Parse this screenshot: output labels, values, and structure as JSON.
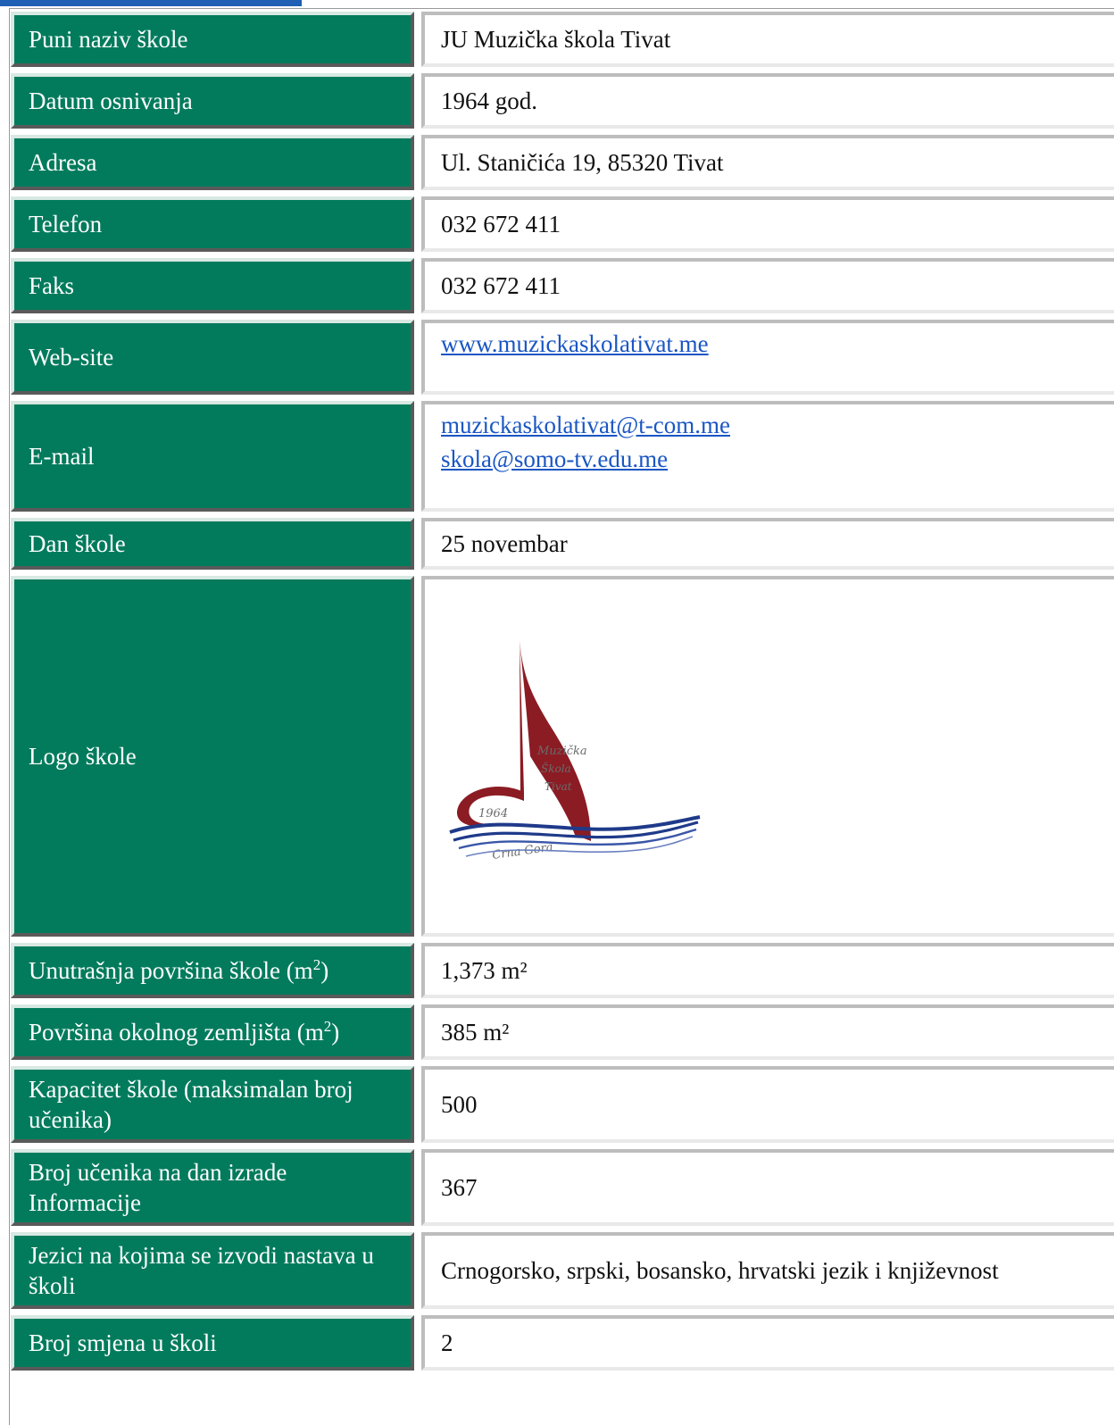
{
  "rows": {
    "full_name": {
      "label": "Puni naziv škole",
      "value": "JU Muzička škola Tivat"
    },
    "founded": {
      "label": "Datum osnivanja",
      "value": "1964 god."
    },
    "address": {
      "label": "Adresa",
      "value": "Ul. Staničića 19, 85320 Tivat"
    },
    "phone": {
      "label": "Telefon",
      "value": "032 672 411"
    },
    "fax": {
      "label": "Faks",
      "value": "032 672 411"
    },
    "website": {
      "label": "Web-site",
      "value": "www.muzickaskolativat.me"
    },
    "email": {
      "label": "E-mail",
      "value_1": "muzickaskolativat@t-com.me",
      "value_2": "skola@somo-tv.edu.me"
    },
    "school_day": {
      "label": "Dan škole",
      "value": "25 novembar"
    },
    "logo": {
      "label": "Logo škole",
      "logo_text": [
        "Muzička",
        "Škola",
        "Tivat",
        "1964",
        "Crna Gora"
      ]
    },
    "inner_area": {
      "label": "Unutrašnja površina škole (m",
      "label_sup": "2",
      "label_end": ")",
      "value": "1,373 m²"
    },
    "land_area": {
      "label": "Površina okolnog zemljišta (m",
      "label_sup": "2",
      "label_end": ")",
      "value": "385 m²"
    },
    "capacity": {
      "label": "Kapacitet škole (maksimalan broj učenika)",
      "value": "500"
    },
    "students": {
      "label": "Broj učenika na dan izrade Informacije",
      "value": "367"
    },
    "languages": {
      "label": "Jezici na kojima se izvodi nastava u školi",
      "value": "Crnogorsko, srpski, bosansko, hrvatski jezik i književnost"
    },
    "shifts": {
      "label": "Broj smjena u školi",
      "value": "2"
    }
  },
  "colors": {
    "label_bg": "#027b5d",
    "link": "#1a56c4",
    "top_bar": "#1f5fb4",
    "logo_red": "#8b1c24",
    "logo_blue": "#1f3a8a"
  }
}
